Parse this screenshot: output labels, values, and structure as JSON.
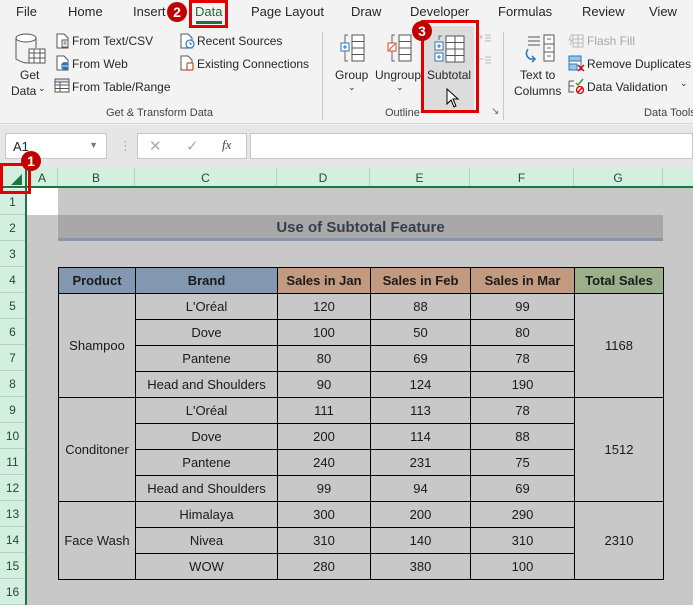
{
  "menu": {
    "tabs": [
      {
        "label": "File"
      },
      {
        "label": "Home"
      },
      {
        "label": "Insert"
      },
      {
        "label": "Data",
        "active": true
      },
      {
        "label": "Page Layout"
      },
      {
        "label": "Draw"
      },
      {
        "label": "Developer"
      },
      {
        "label": "Formulas"
      },
      {
        "label": "Review"
      },
      {
        "label": "View"
      }
    ]
  },
  "ribbon": {
    "get_transform": {
      "get_data_line1": "Get",
      "get_data_line2": "Data",
      "from_text_csv": "From Text/CSV",
      "from_web": "From Web",
      "from_table_range": "From Table/Range",
      "recent_sources": "Recent Sources",
      "existing_connections": "Existing Connections",
      "group_label": "Get & Transform Data"
    },
    "outline": {
      "group": "Group",
      "ungroup": "Ungroup",
      "subtotal": "Subtotal",
      "group_label": "Outline"
    },
    "data_tools": {
      "text_to_columns_line1": "Text to",
      "text_to_columns_line2": "Columns",
      "flash_fill": "Flash Fill",
      "remove_duplicates": "Remove Duplicates",
      "data_validation": "Data Validation",
      "group_label": "Data Tools"
    }
  },
  "formula_bar": {
    "name_box": "A1",
    "fx": "fx",
    "value": ""
  },
  "grid": {
    "columns": [
      "A",
      "B",
      "C",
      "D",
      "E",
      "F",
      "G"
    ],
    "rows": [
      "1",
      "2",
      "3",
      "4",
      "5",
      "6",
      "7",
      "8",
      "9",
      "10",
      "11",
      "12",
      "13",
      "14",
      "15",
      "16"
    ]
  },
  "sheet": {
    "title": "Use of Subtotal Feature",
    "headers": [
      "Product",
      "Brand",
      "Sales in Jan",
      "Sales in Feb",
      "Sales in Mar",
      "Total Sales"
    ],
    "groups": [
      {
        "product": "Shampoo",
        "total": "1168",
        "rows": [
          {
            "brand": "L'Oréal",
            "jan": "120",
            "feb": "88",
            "mar": "99"
          },
          {
            "brand": "Dove",
            "jan": "100",
            "feb": "50",
            "mar": "80"
          },
          {
            "brand": "Pantene",
            "jan": "80",
            "feb": "69",
            "mar": "78"
          },
          {
            "brand": "Head and Shoulders",
            "jan": "90",
            "feb": "124",
            "mar": "190"
          }
        ]
      },
      {
        "product": "Conditoner",
        "total": "1512",
        "rows": [
          {
            "brand": "L'Oréal",
            "jan": "111",
            "feb": "113",
            "mar": "78"
          },
          {
            "brand": "Dove",
            "jan": "200",
            "feb": "114",
            "mar": "88"
          },
          {
            "brand": "Pantene",
            "jan": "240",
            "feb": "231",
            "mar": "75"
          },
          {
            "brand": "Head and Shoulders",
            "jan": "99",
            "feb": "94",
            "mar": "69"
          }
        ]
      },
      {
        "product": "Face Wash",
        "total": "2310",
        "rows": [
          {
            "brand": "Himalaya",
            "jan": "300",
            "feb": "200",
            "mar": "290"
          },
          {
            "brand": "Nivea",
            "jan": "310",
            "feb": "140",
            "mar": "310"
          },
          {
            "brand": "WOW",
            "jan": "280",
            "feb": "380",
            "mar": "100"
          }
        ]
      }
    ]
  },
  "annotations": {
    "step1": "1",
    "step2": "2",
    "step3": "3"
  },
  "colors": {
    "accent_green": "#217346",
    "annotation_red": "#e00000",
    "header_blue": "#8497b0",
    "header_tan": "#c19a7f",
    "header_green": "#9bb08a"
  }
}
